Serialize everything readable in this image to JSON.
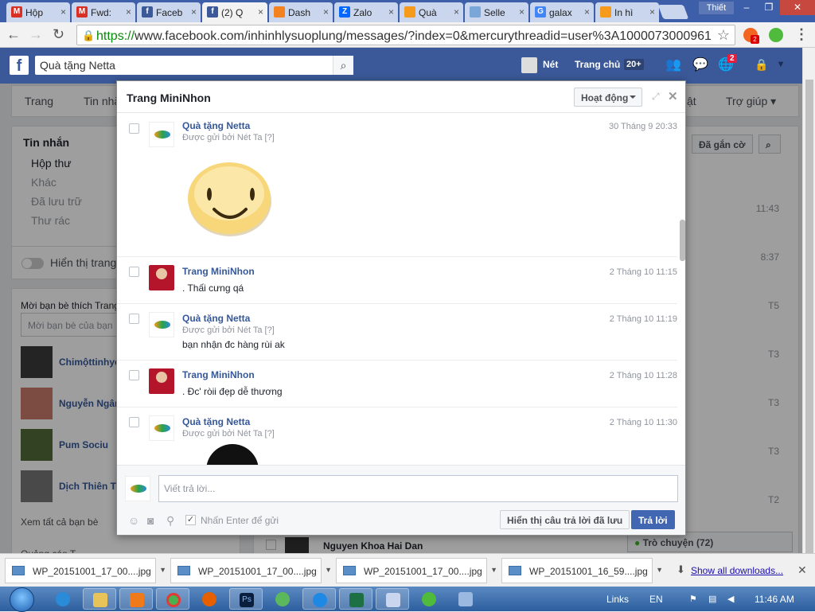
{
  "browser": {
    "tabs": [
      {
        "label": "Hộp",
        "icon": "gmail-icon",
        "color": "#d93025"
      },
      {
        "label": "Fwd:",
        "icon": "gmail-icon",
        "color": "#d93025"
      },
      {
        "label": "Faceb",
        "icon": "facebook-icon",
        "color": "#3b5998"
      },
      {
        "label": "(2) Q",
        "icon": "facebook-icon",
        "color": "#3b5998"
      },
      {
        "label": "Dash",
        "icon": "dashboard-icon",
        "color": "#f58220"
      },
      {
        "label": "Zalo",
        "icon": "zalo-icon",
        "color": "#0068ff"
      },
      {
        "label": "Quà",
        "icon": "netta-icon",
        "color": "#f59a1b"
      },
      {
        "label": "Selle",
        "icon": "seller-icon",
        "color": "#7aa6d8"
      },
      {
        "label": "galax",
        "icon": "google-icon",
        "color": "#4285f4"
      },
      {
        "label": "In hì",
        "icon": "netta-icon",
        "color": "#f59a1b"
      }
    ],
    "user_label": "Thiết",
    "url_scheme": "https://",
    "url_rest": "www.facebook.com/inhinhlysuoplung/messages/?index=0&mercurythreadid=user%3A1000073000961",
    "ext_badge": "2"
  },
  "facebook": {
    "search_value": "Quà tặng Netta",
    "nav_net": "Nét",
    "nav_home": "Trang chủ",
    "home_badge": "20+",
    "notif_badge": "2",
    "page_tabs": [
      "Trang",
      "Tin nhắ",
      "ật",
      "Trợ giúp ▾"
    ]
  },
  "sidebar": {
    "title": "Tin nhắn",
    "items": [
      "Hộp thư",
      "Khác",
      "Đã lưu trữ",
      "Thư rác"
    ]
  },
  "toggle_label": "Hiển thị trang",
  "friends": {
    "title": "Mời bạn bè thích Trang",
    "placeholder": "Mời bạn bè của bạn",
    "list": [
      "Chimộttinhye",
      "Nguyễn Ngân",
      "Pum Sociu",
      "Dịch Thiên Th"
    ],
    "see_all": "Xem tất cả bạn bè",
    "next_label": "Quảng cáo T"
  },
  "right_list": {
    "flag_btn": "Đã gắn cờ",
    "times": [
      "11:43",
      "8:37",
      "T5",
      "T3",
      "T3",
      "T3",
      "T2"
    ],
    "bg_name": "Nguyen Khoa Hai Dan",
    "chat_label": "Trò chuyện (72)"
  },
  "dialog": {
    "title": "Trang MiniNhon",
    "status": "Hoạt động",
    "messages": [
      {
        "sender": "Quà tặng Netta",
        "via": "Được gửi bởi Nét Ta",
        "via_q": "[?]",
        "time": "30 Tháng 9 20:33",
        "text": "",
        "attachment": "smiley-sticker"
      },
      {
        "sender": "Trang MiniNhon",
        "via": "",
        "via_q": "",
        "time": "2 Tháng 10 11:15",
        "text": ". Thấi cưng qá"
      },
      {
        "sender": "Quà tặng Netta",
        "via": "Được gửi bởi Nét Ta",
        "via_q": "[?]",
        "time": "2 Tháng 10 11:19",
        "text": "bạn nhận đc hàng rùi ak"
      },
      {
        "sender": "Trang MiniNhon",
        "via": "",
        "via_q": "",
        "time": "2 Tháng 10 11:28",
        "text": ". Đc' ròii đẹp dễ thương"
      },
      {
        "sender": "Quà tặng Netta",
        "via": "Được gửi bởi Nét Ta",
        "via_q": "[?]",
        "time": "2 Tháng 10 11:30",
        "text": "",
        "attachment": "photo"
      }
    ],
    "reply_placeholder": "Viết trả lời...",
    "enter_label": "Nhấn Enter để gửi",
    "saved_btn": "Hiển thị câu trả lời đã lưu",
    "reply_btn": "Trả lời"
  },
  "downloads": {
    "items": [
      "WP_20151001_17_00....jpg",
      "WP_20151001_17_00....jpg",
      "WP_20151001_17_00....jpg",
      "WP_20151001_16_59....jpg"
    ],
    "show_all": "Show all downloads..."
  },
  "taskbar": {
    "links": "Links",
    "lang": "EN",
    "time": "11:46 AM"
  }
}
